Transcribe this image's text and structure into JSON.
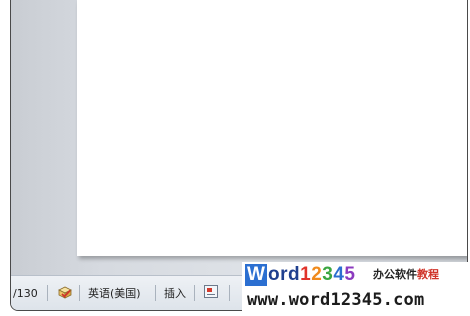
{
  "statusbar": {
    "word_count": "/130",
    "spell_check_icon": "book-check-icon",
    "language": "英语(美国)",
    "insert_mode": "插入",
    "macro_icon": "macro-record-icon"
  },
  "watermark": {
    "logo_letter": "W",
    "brand_ord": "ord",
    "brand_digits": [
      "1",
      "2",
      "3",
      "4",
      "5"
    ],
    "tagline_black": "办公软件",
    "tagline_red": "教程",
    "url": "www.word12345.com"
  },
  "colors": {
    "statusbar_bg": "#e6eaef",
    "workspace_bg": "#d6dae0",
    "brand_blue": "#2b6fd1",
    "brand_red": "#e0332b"
  }
}
